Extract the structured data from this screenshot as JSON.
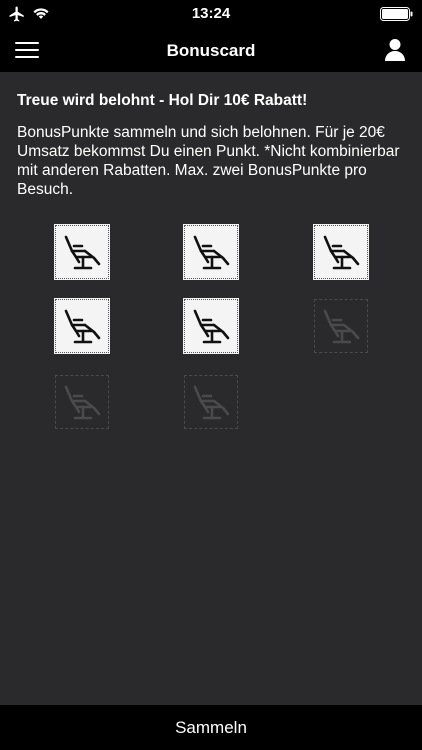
{
  "status_bar": {
    "time": "13:24",
    "icons": [
      "airplane-icon",
      "wifi-icon",
      "battery-icon"
    ]
  },
  "nav": {
    "title": "Bonuscard",
    "menu_icon": "hamburger-menu-icon",
    "profile_icon": "user-icon"
  },
  "main": {
    "headline": "Treue wird belohnt - Hol Dir 10€ Rabatt!",
    "description": "BonusPunkte sammeln und sich belohnen. Für je 20€ Umsatz bekommst Du einen Punkt. *Nicht kombinierbar mit anderen Rabatten. Max. zwei BonusPunkte pro Besuch."
  },
  "stamps": {
    "icon": "salon-chair-icon",
    "total": 8,
    "collected": 5
  },
  "bottom": {
    "action_label": "Sammeln"
  },
  "colors": {
    "background": "#2a2a2c",
    "bars": "#000000",
    "stamp_filled": "#f4f4f4",
    "stamp_empty": "#4a4a4a"
  }
}
